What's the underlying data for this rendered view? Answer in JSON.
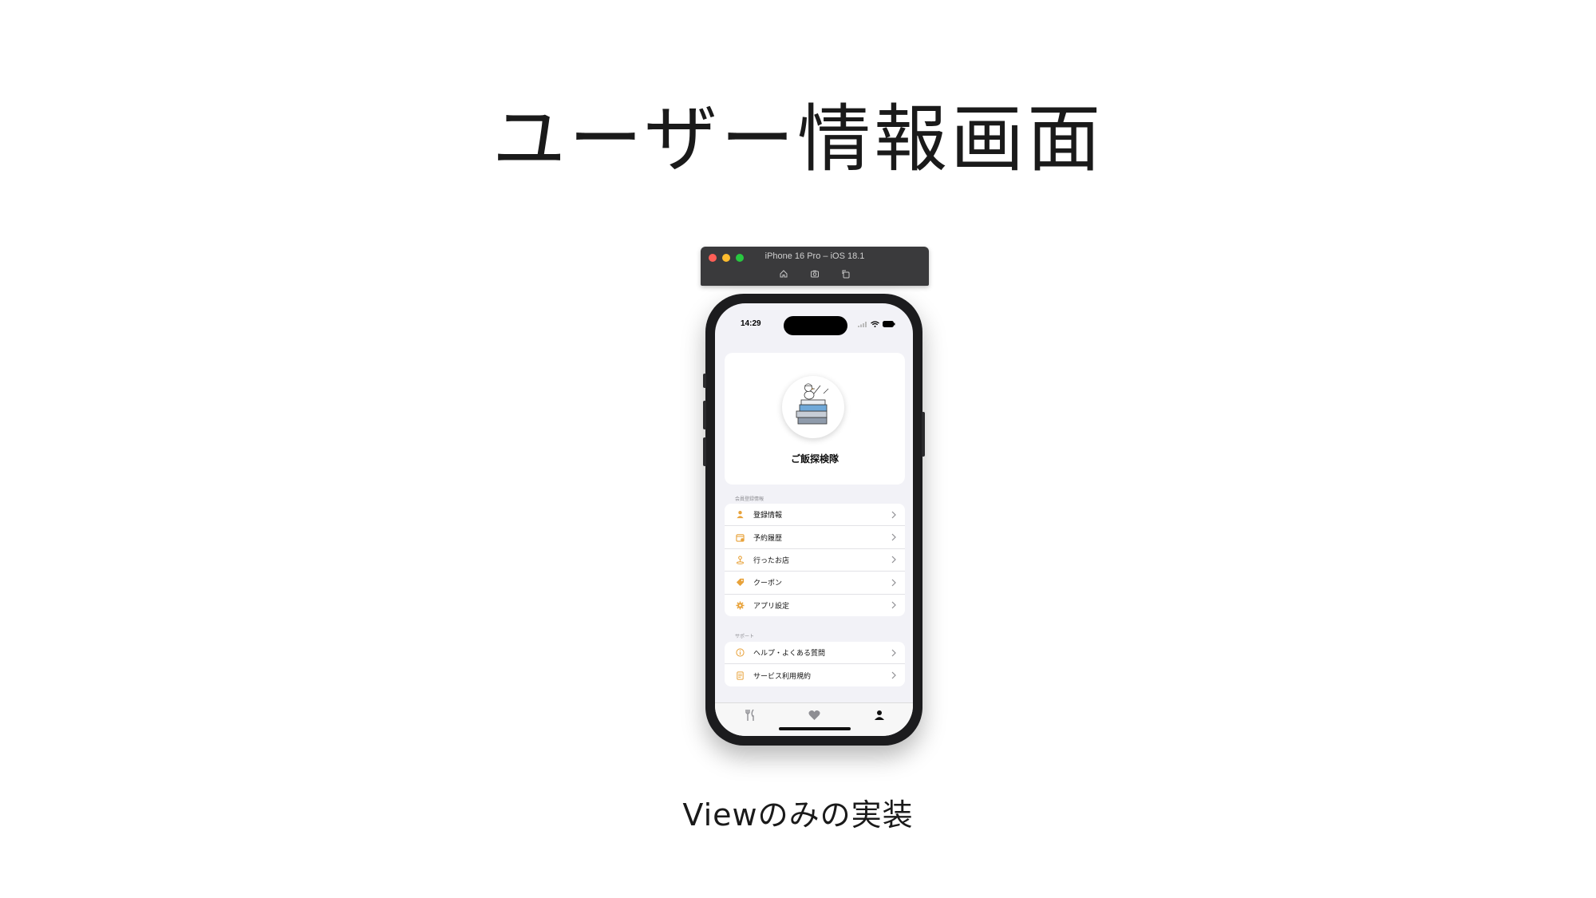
{
  "slide": {
    "title": "ユーザー情報画面",
    "caption": "Viewのみの実装"
  },
  "simulator": {
    "window_title": "iPhone 16 Pro – iOS 18.1",
    "toolbar_icons": [
      "home-icon",
      "screenshot-icon",
      "rotate-icon"
    ]
  },
  "status_bar": {
    "time": "14:29",
    "icons": [
      "cellular-icon",
      "wifi-icon",
      "battery-icon"
    ]
  },
  "profile": {
    "name": "ご飯探検隊",
    "avatar_icon": "explorer-bird-books-illustration"
  },
  "sections": [
    {
      "header": "会員登録情報",
      "items": [
        {
          "label": "登録情報",
          "icon": "person-icon"
        },
        {
          "label": "予約履歴",
          "icon": "calendar-icon"
        },
        {
          "label": "行ったお店",
          "icon": "location-pin-icon"
        },
        {
          "label": "クーポン",
          "icon": "tag-icon"
        },
        {
          "label": "アプリ設定",
          "icon": "gear-icon"
        }
      ]
    },
    {
      "header": "サポート",
      "items": [
        {
          "label": "ヘルプ・よくある質問",
          "icon": "info-icon"
        },
        {
          "label": "サービス利用規約",
          "icon": "document-icon"
        }
      ]
    }
  ],
  "tabs": [
    {
      "icon": "fork-knife-icon",
      "selected": false
    },
    {
      "icon": "heart-icon",
      "selected": false
    },
    {
      "icon": "person-icon",
      "selected": true
    }
  ],
  "colors": {
    "accent": "#e8a23a",
    "screen_bg": "#f2f2f7",
    "tab_selected": "#111111",
    "tab_unselected": "#8e8e93"
  }
}
